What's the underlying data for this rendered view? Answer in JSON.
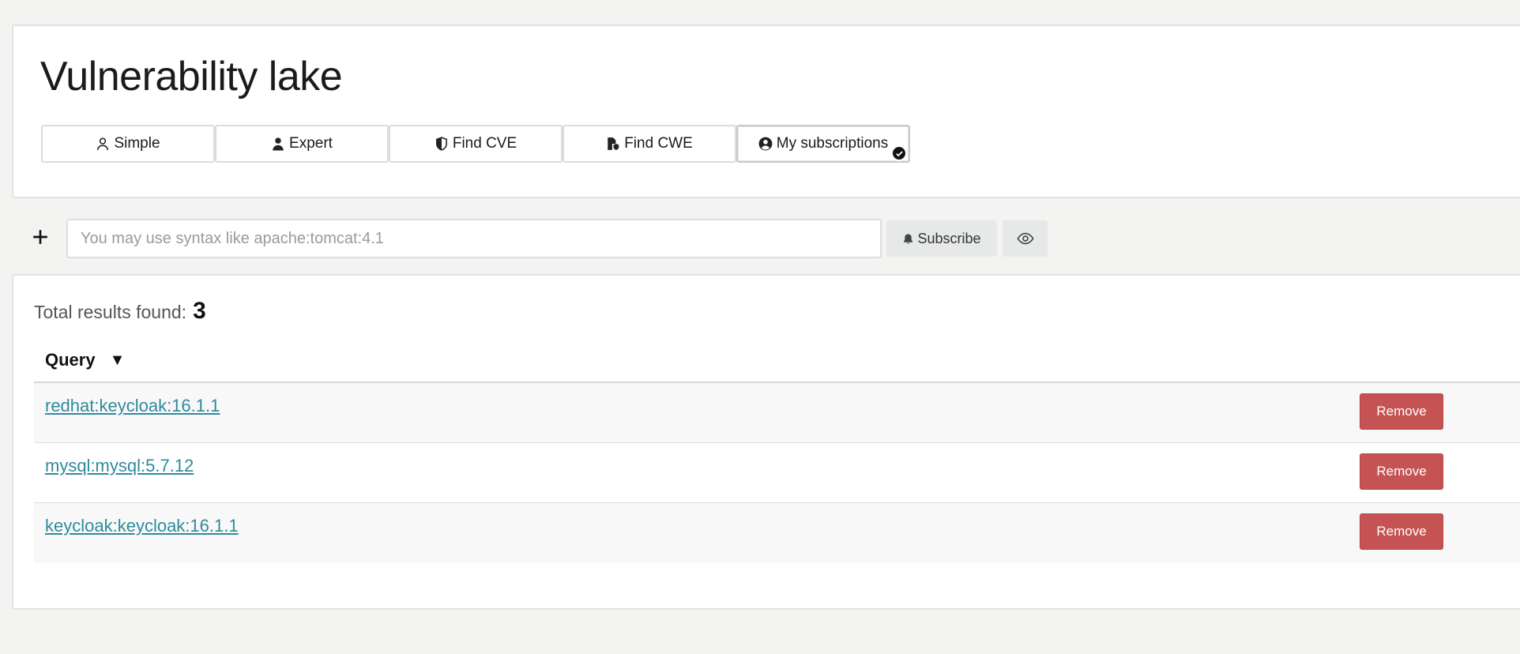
{
  "header": {
    "title": "Vulnerability lake",
    "tabs": [
      {
        "label": "Simple",
        "icon": "user-outline-icon"
      },
      {
        "label": "Expert",
        "icon": "user-solid-icon"
      },
      {
        "label": "Find CVE",
        "icon": "shield-half-icon"
      },
      {
        "label": "Find CWE",
        "icon": "file-shield-icon"
      },
      {
        "label": "My subscriptions",
        "icon": "user-circle-icon",
        "active": true
      }
    ]
  },
  "subscribe_bar": {
    "search_placeholder": "You may use syntax like apache:tomcat:4.1",
    "search_value": "",
    "subscribe_label": "Subscribe"
  },
  "results": {
    "total_label": "Total results found:",
    "total_count": "3",
    "column_query": "Query",
    "sort_indicator": "▼",
    "rows": [
      {
        "query": "redhat:keycloak:16.1.1",
        "action": "Remove"
      },
      {
        "query": "mysql:mysql:5.7.12",
        "action": "Remove"
      },
      {
        "query": "keycloak:keycloak:16.1.1",
        "action": "Remove"
      }
    ]
  },
  "colors": {
    "link": "#2f8a9c",
    "remove_button": "#c55353",
    "background": "#f3f3f2"
  }
}
